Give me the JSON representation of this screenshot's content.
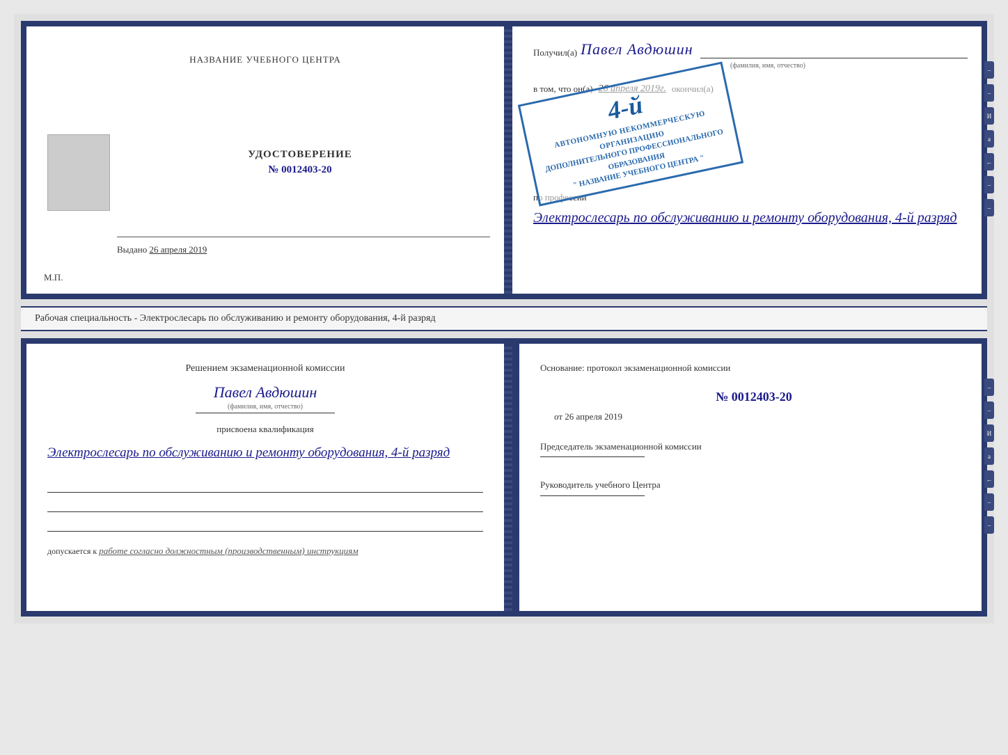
{
  "top_left": {
    "training_center": "НАЗВАНИЕ УЧЕБНОГО ЦЕНТРА",
    "certificate_label": "УДОСТОВЕРЕНИЕ",
    "certificate_number": "№ 0012403-20",
    "issued_prefix": "Выдано",
    "issued_date": "26 апреля 2019",
    "mp_label": "М.П."
  },
  "top_right": {
    "received_prefix": "Получил(а)",
    "recipient_name": "Павел Авдюшин",
    "name_hint": "(фамилия, имя, отчество)",
    "in_that_prefix": "в том, что он(а)",
    "date_handwritten": "26 апреля 2019г.",
    "finished_label": "окончил(а)",
    "stamp_line1": "АВТОНОМНУЮ НЕКОММЕРЧЕСКУЮ ОРГАНИЗАЦИЮ",
    "stamp_line2": "ДОПОЛНИТЕЛЬНОГО ПРОФЕССИОНАЛЬНОГО ОБРАЗОВАНИЯ",
    "stamp_line3": "\" НАЗВАНИЕ УЧЕБНОГО ЦЕНТРА \"",
    "stamp_number": "4-й",
    "profession_prefix": "по профессии",
    "profession_handwritten": "Электрослесарь по обслуживанию и ремонту оборудования, 4-й разряд"
  },
  "middle": {
    "text": "Рабочая специальность - Электрослесарь по обслуживанию и ремонту оборудования, 4-й разряд"
  },
  "bottom_left": {
    "commission_text": "Решением экзаменационной комиссии",
    "person_name": "Павел Авдюшин",
    "name_hint": "(фамилия, имя, отчество)",
    "qualification_label": "присвоена квалификация",
    "qualification_handwritten": "Электрослесарь по обслуживанию и ремонту оборудования, 4-й разряд",
    "allowed_prefix": "допускается к",
    "allowed_handwritten": "работе согласно должностным (производственным) инструкциям"
  },
  "bottom_right": {
    "basis_label": "Основание: протокол экзаменационной комиссии",
    "protocol_number": "№  0012403-20",
    "protocol_date_prefix": "от",
    "protocol_date": "26 апреля 2019",
    "chairman_role": "Председатель экзаменационной комиссии",
    "director_role": "Руководитель учебного Центра"
  },
  "side_tabs": [
    "И",
    "а",
    "←",
    "–",
    "–",
    "–",
    "–"
  ]
}
